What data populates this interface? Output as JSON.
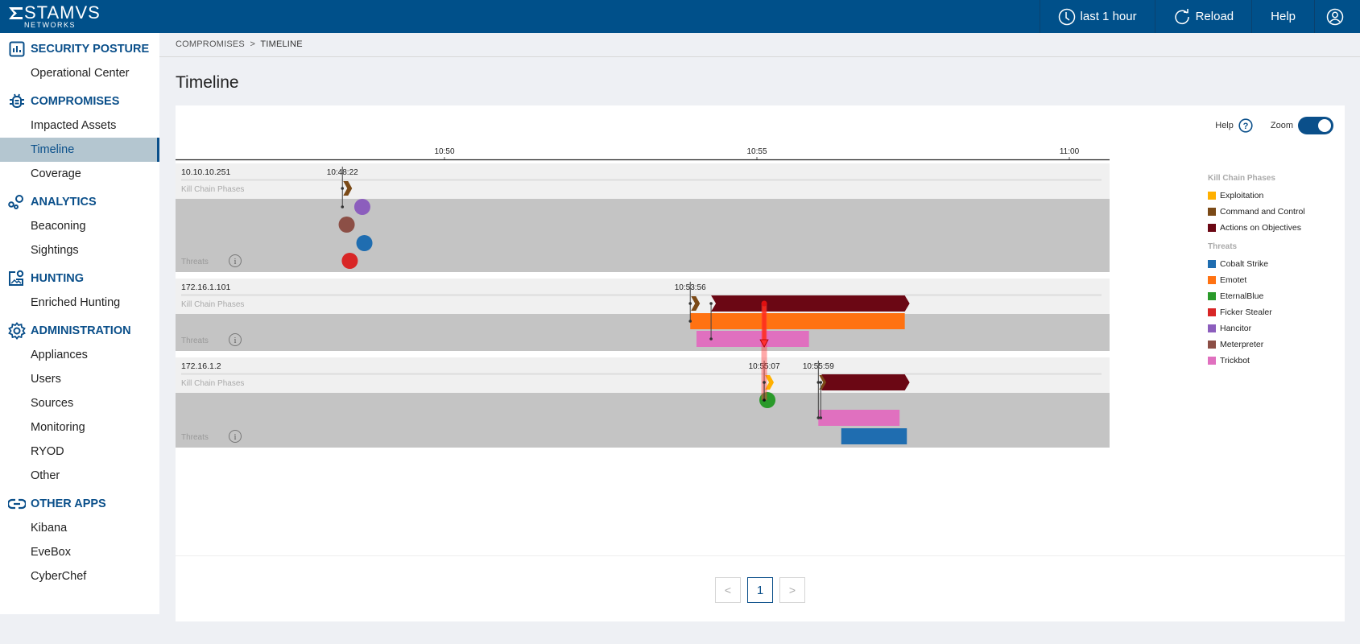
{
  "brand": {
    "name": "STAMVS",
    "sub": "NETWORKS"
  },
  "topbar": {
    "time_range": "last 1 hour",
    "reload": "Reload",
    "help": "Help",
    "icons": {
      "time": "clock-icon",
      "reload": "reload-icon",
      "user": "user-icon"
    }
  },
  "sidebar": {
    "sections": [
      {
        "title": "SECURITY POSTURE",
        "icon": "chart-icon",
        "items": [
          "Operational Center"
        ]
      },
      {
        "title": "COMPROMISES",
        "icon": "bug-icon",
        "items": [
          "Impacted Assets",
          "Timeline",
          "Coverage"
        ]
      },
      {
        "title": "ANALYTICS",
        "icon": "analytics-icon",
        "items": [
          "Beaconing",
          "Sightings"
        ]
      },
      {
        "title": "HUNTING",
        "icon": "hunting-icon",
        "items": [
          "Enriched Hunting"
        ]
      },
      {
        "title": "ADMINISTRATION",
        "icon": "gear-icon",
        "items": [
          "Appliances",
          "Users",
          "Sources",
          "Monitoring",
          "RYOD",
          "Other"
        ]
      },
      {
        "title": "OTHER APPS",
        "icon": "link-icon",
        "items": [
          "Kibana",
          "EveBox",
          "CyberChef"
        ]
      }
    ],
    "active_item": "Timeline"
  },
  "breadcrumb": {
    "parent": "COMPROMISES",
    "sep": ">",
    "current": "TIMELINE"
  },
  "page_title": "Timeline",
  "controls": {
    "help": "Help",
    "zoom": "Zoom",
    "zoom_enabled": true
  },
  "pagination": {
    "prev": "<",
    "current": "1",
    "next": ">"
  },
  "colors": {
    "Exploitation": "#ffb000",
    "Command and Control": "#7b4a17",
    "Actions on Objectives": "#6b0714",
    "Cobalt Strike": "#1f6db0",
    "Emotet": "#ff7212",
    "EternalBlue": "#2a9a2a",
    "Ficker Stealer": "#d82626",
    "Hancitor": "#8c5ebd",
    "Meterpreter": "#8c4f46",
    "Trickbot": "#e070bf"
  },
  "legend": {
    "kill_chain_title": "Kill Chain Phases",
    "kill_chain": [
      "Exploitation",
      "Command and Control",
      "Actions on Objectives"
    ],
    "threats_title": "Threats",
    "threats": [
      "Cobalt Strike",
      "Emotet",
      "EternalBlue",
      "Ficker Stealer",
      "Hancitor",
      "Meterpreter",
      "Trickbot"
    ]
  },
  "chart_data": {
    "type": "timeline",
    "x_range": [
      "10:45:40",
      "11:00:40"
    ],
    "ticks": [
      "10:50",
      "10:55",
      "11:00"
    ],
    "row_labels": {
      "kill_chain": "Kill Chain Phases",
      "threats": "Threats"
    },
    "hosts": [
      {
        "ip": "10.10.10.251",
        "marker_time": "10:48:22",
        "kill_chain": [
          {
            "phase": "Command and Control",
            "start": "10:48:22",
            "end": "10:48:22"
          }
        ],
        "threats": [
          {
            "name": "Hancitor",
            "start": "10:48:38",
            "end": "10:48:38",
            "lane": 0
          },
          {
            "name": "Meterpreter",
            "start": "10:48:23",
            "end": "10:48:23",
            "lane": 1
          },
          {
            "name": "Cobalt Strike",
            "start": "10:48:40",
            "end": "10:48:40",
            "lane": 2
          },
          {
            "name": "Ficker Stealer",
            "start": "10:48:26",
            "end": "10:48:26",
            "lane": 3
          }
        ]
      },
      {
        "ip": "172.16.1.101",
        "marker_time": "10:53:56",
        "kill_chain": [
          {
            "phase": "Command and Control",
            "start": "10:53:56",
            "end": "10:53:56"
          },
          {
            "phase": "Actions on Objectives",
            "start": "10:54:16",
            "end": "10:57:22"
          }
        ],
        "threats": [
          {
            "name": "Emotet",
            "start": "10:53:56",
            "end": "10:57:22",
            "lane": 0
          },
          {
            "name": "Trickbot",
            "start": "10:54:02",
            "end": "10:55:50",
            "lane": 1
          }
        ]
      },
      {
        "ip": "172.16.1.2",
        "marker_time": "10:55:07",
        "marker_time_2": "10:55:59",
        "kill_chain": [
          {
            "phase": "Exploitation",
            "start": "10:55:07",
            "end": "10:55:07"
          },
          {
            "phase": "Command and Control",
            "start": "10:55:59",
            "end": "10:55:59"
          },
          {
            "phase": "Actions on Objectives",
            "start": "10:56:02",
            "end": "10:57:22"
          }
        ],
        "threats": [
          {
            "name": "EternalBlue",
            "start": "10:55:07",
            "end": "10:55:07",
            "lane": 0
          },
          {
            "name": "Trickbot",
            "start": "10:55:59",
            "end": "10:57:17",
            "lane": 1
          },
          {
            "name": "Cobalt Strike",
            "start": "10:56:21",
            "end": "10:57:24",
            "lane": 2
          }
        ]
      }
    ],
    "lateral_movement": {
      "from": "172.16.1.101",
      "to": "172.16.1.2",
      "time": "10:55:07"
    }
  }
}
